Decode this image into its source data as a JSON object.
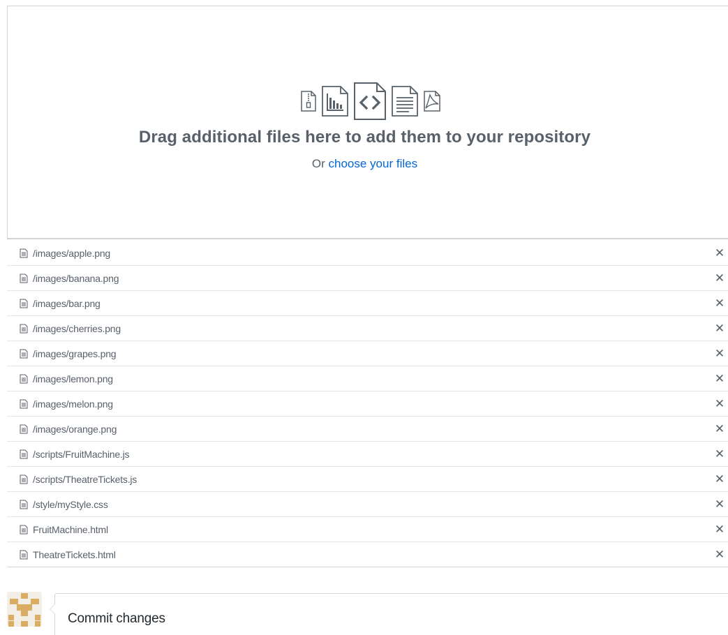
{
  "dropzone": {
    "icons": [
      "zip-file-icon",
      "chart-file-icon",
      "code-file-icon",
      "text-file-icon",
      "pdf-file-icon"
    ],
    "title": "Drag additional files here to add them to your repository",
    "sub_prefix": "Or ",
    "sub_link": "choose your files"
  },
  "files": [
    {
      "name": "/images/apple.png"
    },
    {
      "name": "/images/banana.png"
    },
    {
      "name": "/images/bar.png"
    },
    {
      "name": "/images/cherries.png"
    },
    {
      "name": "/images/grapes.png"
    },
    {
      "name": "/images/lemon.png"
    },
    {
      "name": "/images/melon.png"
    },
    {
      "name": "/images/orange.png"
    },
    {
      "name": "/scripts/FruitMachine.js"
    },
    {
      "name": "/scripts/TheatreTickets.js"
    },
    {
      "name": "/style/myStyle.css"
    },
    {
      "name": "FruitMachine.html"
    },
    {
      "name": "TheatreTickets.html"
    }
  ],
  "remove_glyph": "✕",
  "commit": {
    "title": "Commit changes"
  },
  "colors": {
    "link": "#0366d6",
    "muted": "#586069",
    "border": "#d1d5da",
    "avatar": "#d9ad63"
  }
}
